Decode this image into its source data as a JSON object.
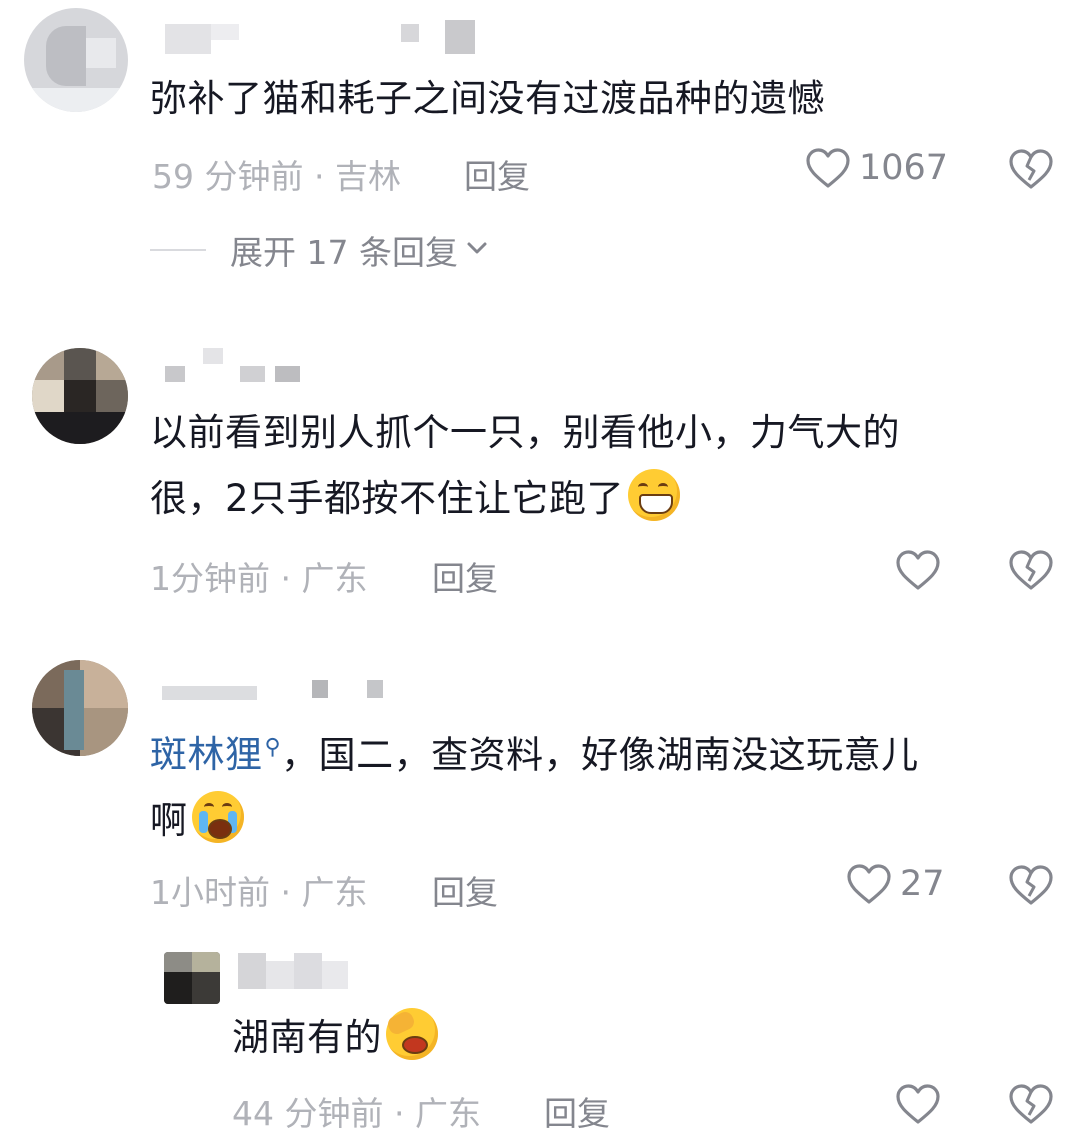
{
  "comments": [
    {
      "text": "弥补了猫和耗子之间没有过渡品种的遗憾",
      "time": "59 分钟前",
      "location": "吉林",
      "reply_label": "回复",
      "likes": "1067",
      "expand_label": "展开 17 条回复"
    },
    {
      "text_line1": "以前看到别人抓个一只，别看他小，力气大的",
      "text_line2": "很，2只手都按不住让它跑了",
      "emoji": "grinning-face-icon",
      "time": "1分钟前",
      "location": "广东",
      "reply_label": "回复",
      "likes": ""
    },
    {
      "mention": "斑林狸",
      "text_line1_rest": "，国二，查资料，好像湖南没这玩意儿",
      "text_line2": "啊",
      "emoji": "crying-face-icon",
      "time": "1小时前",
      "location": "广东",
      "reply_label": "回复",
      "likes": "27"
    },
    {
      "text": "湖南有的",
      "emoji": "facepalm-face-icon",
      "time": "44 分钟前",
      "location": "广东",
      "reply_label": "回复",
      "likes": ""
    }
  ],
  "colors": {
    "text": "#161823",
    "meta": "#b0b2b8",
    "action": "#84868e",
    "mention": "#2e64a6"
  },
  "separator": " · "
}
